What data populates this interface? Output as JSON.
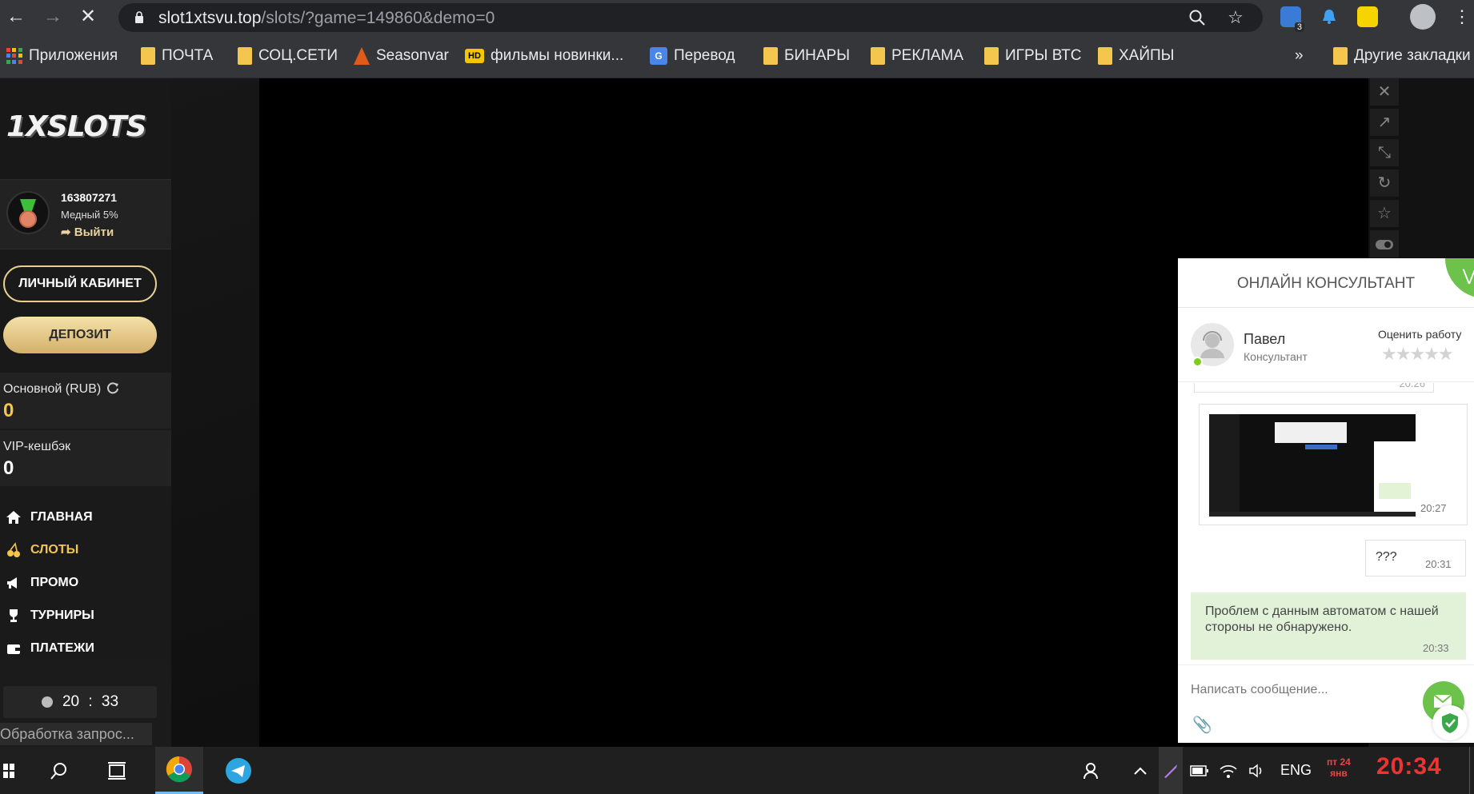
{
  "browser": {
    "url_host": "slot1xtsvu.top",
    "url_path": "/slots/?game=149860&demo=0",
    "ext_badge": "3"
  },
  "bookmarks": [
    {
      "label": "Приложения",
      "icon": "apps-grid-icon"
    },
    {
      "label": "ПОЧТА",
      "icon": "folder-icon"
    },
    {
      "label": "СОЦ.СЕТИ",
      "icon": "folder-icon"
    },
    {
      "label": "Seasonvar",
      "icon": "fox-icon"
    },
    {
      "label": "фильмы новинки...",
      "icon": "hd-icon"
    },
    {
      "label": "Перевод",
      "icon": "translate-icon"
    },
    {
      "label": "БИНАРЫ",
      "icon": "folder-icon"
    },
    {
      "label": "РЕКЛАМА",
      "icon": "folder-icon"
    },
    {
      "label": "ИГРЫ ВТС",
      "icon": "folder-icon"
    },
    {
      "label": "ХАЙПЫ",
      "icon": "folder-icon"
    }
  ],
  "bookmarks_more": "»",
  "bookmarks_other": "Другие закладки",
  "site": {
    "logo": "1XSLOTS",
    "user_id": "163807271",
    "user_level": "Медный 5%",
    "logout": "➦ Выйти",
    "cabinet_btn": "ЛИЧНЫЙ КАБИНЕТ",
    "deposit_btn": "ДЕПОЗИТ",
    "balance_main_label": "Основной (RUB)",
    "balance_main_value": "0",
    "balance_vip_label": "VIP-кешбэк",
    "balance_vip_value": "0",
    "nav": [
      {
        "label": "ГЛАВНАЯ",
        "icon": "home-icon"
      },
      {
        "label": "СЛОТЫ",
        "icon": "cherries-icon"
      },
      {
        "label": "ПРОМО",
        "icon": "megaphone-icon"
      },
      {
        "label": "ТУРНИРЫ",
        "icon": "trophy-icon"
      },
      {
        "label": "ПЛАТЕЖИ",
        "icon": "wallet-icon"
      }
    ],
    "clock_h": "20",
    "clock_sep": ":",
    "clock_m": "33",
    "status": "Обработка запрос..."
  },
  "chat": {
    "title": "ОНЛАЙН КОНСУЛЬТАНТ",
    "agent_name": "Павел",
    "agent_role": "Консультант",
    "rate_label": "Оценить работу",
    "stars": "★★★★★",
    "prev_time": "20:26",
    "messages": [
      {
        "type": "image",
        "time": "20:27"
      },
      {
        "type": "text",
        "text": "???",
        "time": "20:31"
      },
      {
        "type": "text",
        "text": "Проблем с данным автоматом с нашей стороны не обнаружено.",
        "time": "20:33"
      }
    ],
    "input_placeholder": "Написать сообщение..."
  },
  "taskbar": {
    "lang": "ENG",
    "date_day": "пт 24",
    "date_month": "янв",
    "time": "20:34"
  },
  "colors": {
    "accent_gold": "#f3c64b",
    "chat_green": "#6cc24a",
    "chat_bubble": "#e2f2d9"
  }
}
